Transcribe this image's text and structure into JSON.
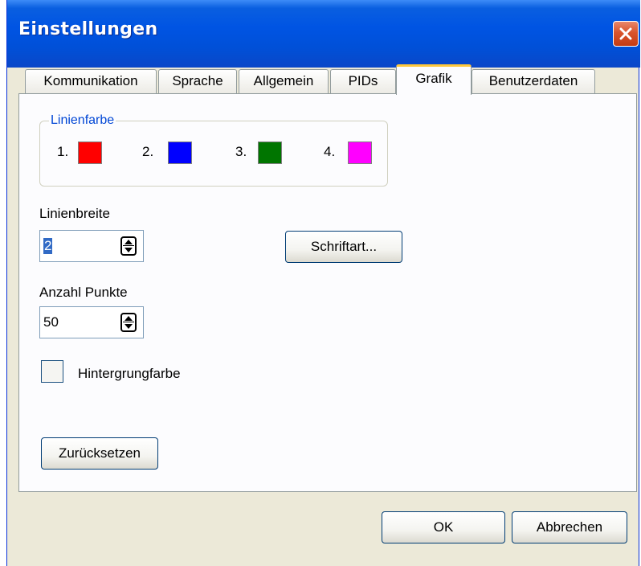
{
  "window": {
    "title": "Einstellungen"
  },
  "tabs": [
    {
      "label": "Kommunikation",
      "active": false
    },
    {
      "label": "Sprache",
      "active": false
    },
    {
      "label": "Allgemein",
      "active": false
    },
    {
      "label": "PIDs",
      "active": false
    },
    {
      "label": "Grafik",
      "active": true
    },
    {
      "label": "Benutzerdaten",
      "active": false
    }
  ],
  "line_color": {
    "group_label": "Linienfarbe",
    "colors": [
      {
        "label": "1.",
        "color": "#ff0000"
      },
      {
        "label": "2.",
        "color": "#0000ff"
      },
      {
        "label": "3.",
        "color": "#007500"
      },
      {
        "label": "4.",
        "color": "#ff00ff"
      }
    ]
  },
  "line_width": {
    "label": "Linienbreite",
    "value": "2"
  },
  "points": {
    "label": "Anzahl Punkte",
    "value": "50"
  },
  "font_button": "Schriftart...",
  "background": {
    "label": "Hintergrungfarbe",
    "checked": false
  },
  "reset_button": "Zurücksetzen",
  "ok_button": "OK",
  "cancel_button": "Abbrechen"
}
